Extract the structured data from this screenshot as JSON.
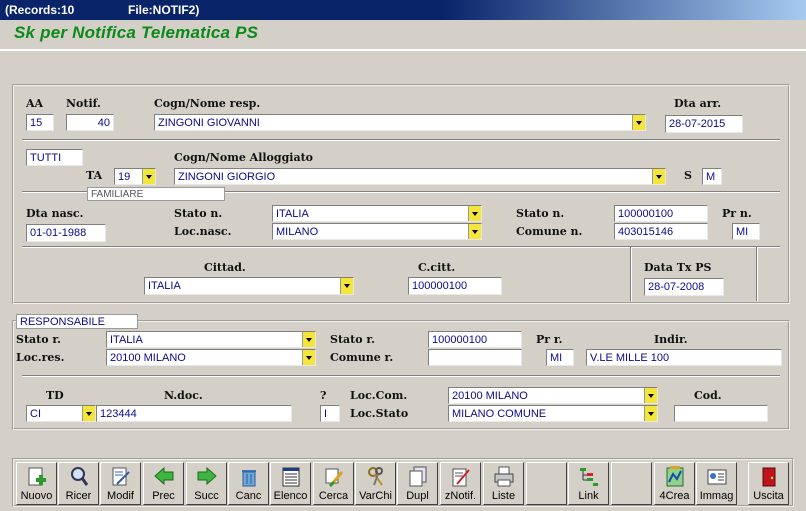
{
  "titlebar": {
    "records": "(Records:10",
    "file": "File:NOTIF2)"
  },
  "app_title": "Sk per Notifica Telematica PS",
  "sec1": {
    "aa_label": "AA",
    "aa_value": "15",
    "notif_label": "Notif.",
    "notif_value": "40",
    "cogn_resp_label": "Cogn/Nome resp.",
    "cogn_resp_value": "ZINGONI GIOVANNI",
    "dta_arr_label": "Dta arr.",
    "dta_arr_value": "28-07-2015",
    "filter_value": "TUTTI",
    "ta_label": "TA",
    "ta_value": "19",
    "cogn_allog_label": "Cogn/Nome Alloggiato",
    "cogn_allog_value": "ZINGONI GIORGIO",
    "s_label": "S",
    "s_value": "M",
    "familiare": "FAMILIARE",
    "dta_nasc_label": "Dta nasc.",
    "dta_nasc_value": "01-01-1988",
    "stato_n_label": "Stato n.",
    "stato_n_value": "ITALIA",
    "stato_n2_label": "Stato n.",
    "stato_n2_value": "100000100",
    "pr_n_label": "Pr n.",
    "pr_n_value": "MI",
    "loc_nasc_label": "Loc.nasc.",
    "loc_nasc_value": "MILANO",
    "comune_n_label": "Comune n.",
    "comune_n_value": "403015146",
    "cittad_label": "Cittad.",
    "cittad_value": "ITALIA",
    "ccitt_label": "C.citt.",
    "ccitt_value": "100000100",
    "data_tx_label": "Data Tx PS",
    "data_tx_value": "28-07-2008"
  },
  "sec2": {
    "responsabile": "RESPONSABILE",
    "stato_r_label": "Stato r.",
    "stato_r_value": "ITALIA",
    "stato_r2_label": "Stato r.",
    "stato_r2_value": "100000100",
    "pr_r_label": "Pr r.",
    "pr_r_value": "MI",
    "indir_label": "Indir.",
    "indir_value": "V.LE MILLE 100",
    "loc_res_label": "Loc.res.",
    "loc_res_value": "20100 MILANO",
    "comune_r_label": "Comune r.",
    "comune_r_value": "",
    "td_label": "TD",
    "td_value": "CI",
    "ndoc_label": "N.doc.",
    "ndoc_value": "123444",
    "q_label": "?",
    "q_value": "I",
    "loc_com_label": "Loc.Com.",
    "loc_com_value": "20100 MILANO",
    "loc_stato_label": "Loc.Stato",
    "loc_stato_value": "MILANO COMUNE",
    "cod_label": "Cod.",
    "cod_value": ""
  },
  "toolbar": [
    {
      "label": "Nuovo",
      "icon": "new-document-icon"
    },
    {
      "label": "Ricer",
      "icon": "magnifier-icon"
    },
    {
      "label": "Modif",
      "icon": "edit-document-icon"
    },
    {
      "label": "Prec",
      "icon": "arrow-left-icon"
    },
    {
      "label": "Succ",
      "icon": "arrow-right-icon"
    },
    {
      "label": "Canc",
      "icon": "trash-icon"
    },
    {
      "label": "Elenco",
      "icon": "list-icon"
    },
    {
      "label": "Cerca",
      "icon": "brush-search-icon"
    },
    {
      "label": "VarChi",
      "icon": "keys-icon"
    },
    {
      "label": "Dupl",
      "icon": "duplicate-icon"
    },
    {
      "label": "zNotif.",
      "icon": "notify-pen-icon"
    },
    {
      "label": "Liste",
      "icon": "printer-icon"
    },
    {
      "label": "",
      "icon": "blank-icon"
    },
    {
      "label": "Link",
      "icon": "link-tree-icon"
    },
    {
      "label": "",
      "icon": "blank-icon"
    },
    {
      "label": "4Crea",
      "icon": "create-map-icon"
    },
    {
      "label": "Immag",
      "icon": "image-card-icon"
    },
    {
      "label": "",
      "icon": "blank-icon"
    },
    {
      "label": "Uscita",
      "icon": "exit-door-icon"
    }
  ],
  "colors": {
    "accent_title": "#0b8a1a",
    "field_text": "#0a0a8a",
    "dropdown_button": "#f4e53a",
    "titlebar": "#0a246a"
  }
}
